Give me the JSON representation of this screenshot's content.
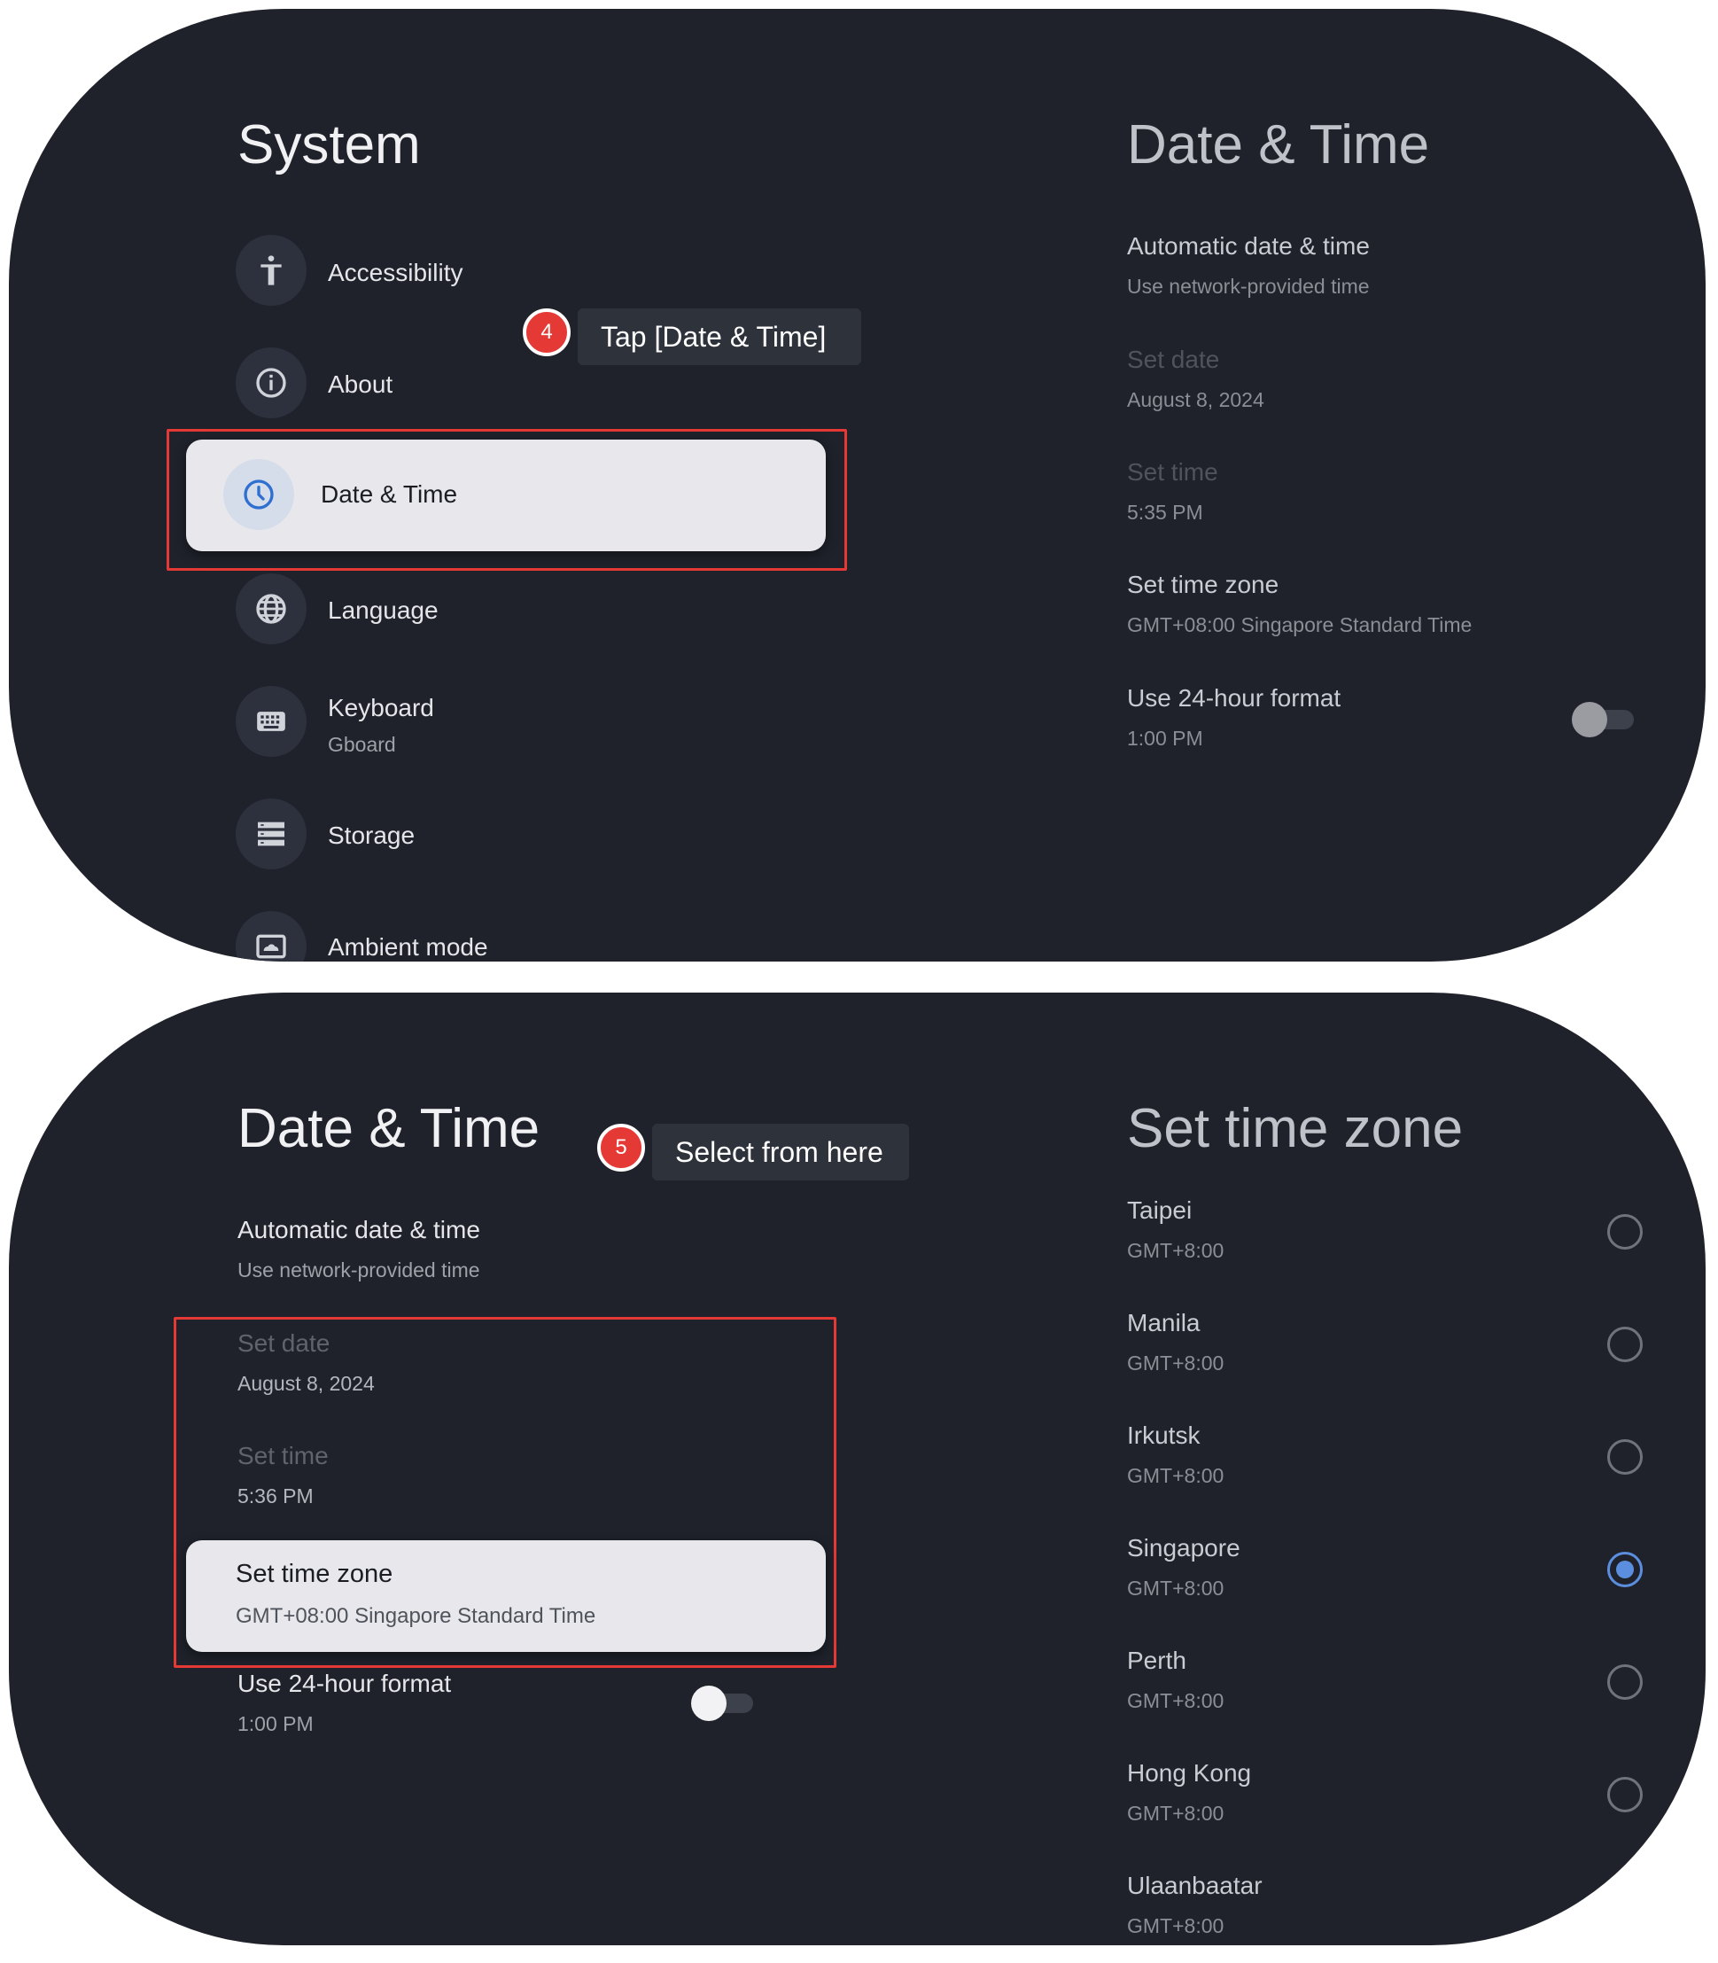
{
  "top": {
    "title": "System",
    "menu": [
      {
        "label": "Accessibility",
        "icon": "accessibility-icon"
      },
      {
        "label": "About",
        "icon": "info-icon"
      },
      {
        "label": "Date & Time",
        "icon": "clock-icon"
      },
      {
        "label": "Language",
        "icon": "globe-icon"
      },
      {
        "label": "Keyboard",
        "sub": "Gboard",
        "icon": "keyboard-icon"
      },
      {
        "label": "Storage",
        "icon": "storage-icon"
      },
      {
        "label": "Ambient mode",
        "icon": "ambient-icon"
      }
    ],
    "callout": {
      "number": "4",
      "text": "Tap [Date & Time]"
    },
    "preview": {
      "title": "Date & Time",
      "items": [
        {
          "label": "Automatic date & time",
          "sub": "Use network-provided time"
        },
        {
          "label": "Set date",
          "sub": "August 8, 2024"
        },
        {
          "label": "Set time",
          "sub": "5:35 PM"
        },
        {
          "label": "Set time zone",
          "sub": "GMT+08:00 Singapore Standard Time"
        },
        {
          "label": "Use 24-hour format",
          "sub": "1:00 PM"
        }
      ]
    }
  },
  "bottom": {
    "title": "Date & Time",
    "callout": {
      "number": "5",
      "text": "Select from here"
    },
    "items": [
      {
        "label": "Automatic date & time",
        "sub": "Use network-provided time"
      },
      {
        "label": "Set date",
        "sub": "August 8, 2024"
      },
      {
        "label": "Set time",
        "sub": "5:36 PM"
      },
      {
        "label": "Set time zone",
        "sub": "GMT+08:00 Singapore Standard Time"
      },
      {
        "label": "Use 24-hour format",
        "sub": "1:00 PM"
      }
    ],
    "timezone_panel": {
      "title": "Set time zone",
      "zones": [
        {
          "city": "Taipei",
          "offset": "GMT+8:00",
          "selected": false
        },
        {
          "city": "Manila",
          "offset": "GMT+8:00",
          "selected": false
        },
        {
          "city": "Irkutsk",
          "offset": "GMT+8:00",
          "selected": false
        },
        {
          "city": "Singapore",
          "offset": "GMT+8:00",
          "selected": true
        },
        {
          "city": "Perth",
          "offset": "GMT+8:00",
          "selected": false
        },
        {
          "city": "Hong Kong",
          "offset": "GMT+8:00",
          "selected": false
        },
        {
          "city": "Ulaanbaatar",
          "offset": "GMT+8:00",
          "selected": false
        }
      ]
    }
  },
  "colors": {
    "panel_bg": "#1f222b",
    "focus_card": "#e8e8ec",
    "highlight_red": "#e53935",
    "accent_blue": "#5c8ee0"
  }
}
